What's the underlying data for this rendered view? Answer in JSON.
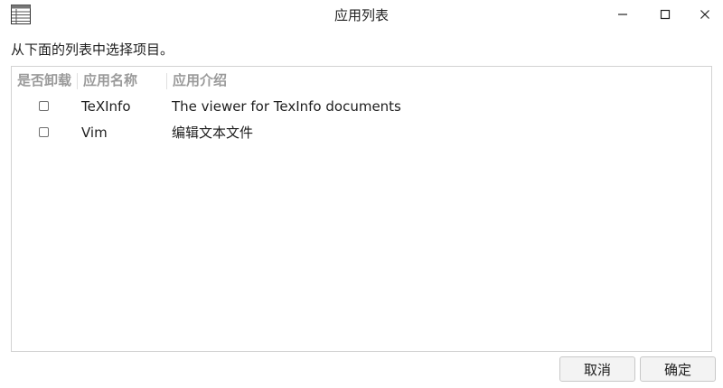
{
  "window": {
    "title": "应用列表",
    "app_icon": "list-window-icon",
    "controls": {
      "minimize_icon": "minimize-icon",
      "maximize_icon": "maximize-icon",
      "close_icon": "close-icon"
    }
  },
  "instruction": "从下面的列表中选择项目。",
  "list": {
    "columns": [
      "是否卸载",
      "应用名称",
      "应用介绍"
    ],
    "rows": [
      {
        "checked": false,
        "name": "TeXInfo",
        "description": "The viewer for TexInfo documents"
      },
      {
        "checked": false,
        "name": "Vim",
        "description": "编辑文本文件"
      }
    ]
  },
  "buttons": {
    "cancel": "取消",
    "ok": "确定"
  },
  "colors": {
    "header_text": "#9a9a9a",
    "border": "#d2d2d2",
    "button_bg": "#f3f3f3"
  }
}
